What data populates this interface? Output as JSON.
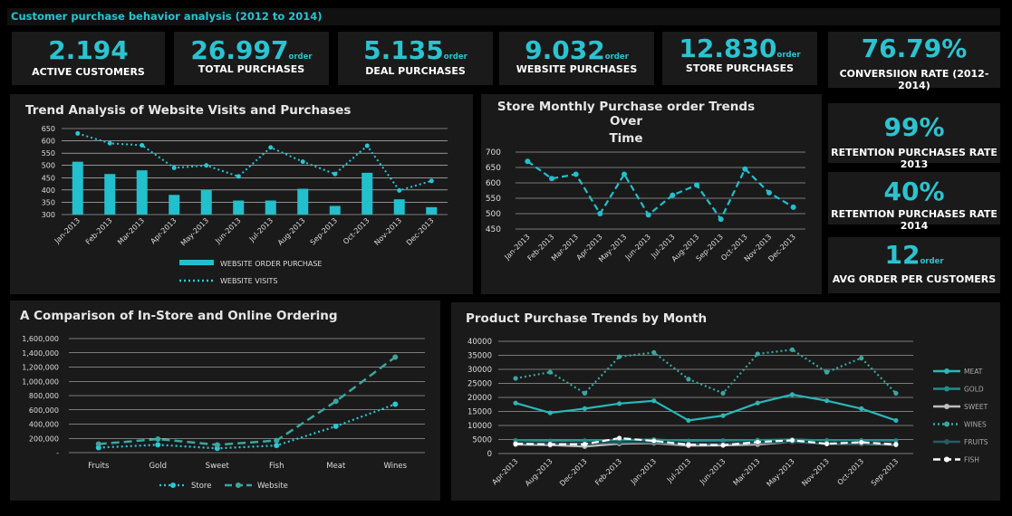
{
  "header": {
    "title": "Customer purchase behavior analysis (2012 to 2014)"
  },
  "kpis": [
    {
      "value": "2.194",
      "unit": "",
      "label": "ACTIVE CUSTOMERS"
    },
    {
      "value": "26.997",
      "unit": "order",
      "label": "TOTAL PURCHASES"
    },
    {
      "value": "5.135",
      "unit": "order",
      "label": "DEAL PURCHASES"
    },
    {
      "value": "9.032",
      "unit": "order",
      "label": "WEBSITE PURCHASES"
    },
    {
      "value": "12.830",
      "unit": "order",
      "label": "STORE PURCHASES"
    },
    {
      "value": "76.79%",
      "unit": "",
      "label": "CONVERSIION RATE (2012-2014)"
    }
  ],
  "side_kpis": [
    {
      "value": "99%",
      "unit": "",
      "label": "RETENTION PURCHASES RATE 2013"
    },
    {
      "value": "40%",
      "unit": "",
      "label": "RETENTION PURCHASES RATE 2014"
    },
    {
      "value": "12",
      "unit": "order",
      "label": "AVG ORDER PER CUSTOMERS"
    }
  ],
  "colors": {
    "accent": "#2cc3d0",
    "teal": "#3aa6a0",
    "panel": "#1a1a1a",
    "background": "#000000"
  },
  "chart_data": [
    {
      "type": "bar",
      "title": "Trend Analysis of Website Visits and Purchases",
      "categories": [
        "Jan-2013",
        "Feb-2013",
        "Mar-2013",
        "Apr-2013",
        "May-2013",
        "Jun-2013",
        "Jul-2013",
        "Aug-2013",
        "Sep-2013",
        "Oct-2013",
        "Nov-2013",
        "Dec-2013"
      ],
      "ylim": [
        300,
        650
      ],
      "yticks": [
        "650",
        "600",
        "550",
        "500",
        "450",
        "400",
        "350",
        "300"
      ],
      "series": [
        {
          "name": "WEBSITE ORDER PURCHASE",
          "type": "bar",
          "values": [
            515,
            465,
            480,
            380,
            400,
            357,
            357,
            405,
            335,
            470,
            362,
            330
          ]
        },
        {
          "name": "WEBSITE VISITS",
          "type": "line",
          "values": [
            630,
            590,
            582,
            490,
            500,
            455,
            573,
            515,
            465,
            580,
            398,
            437
          ]
        }
      ],
      "legend": "bottom",
      "grid": true
    },
    {
      "type": "line",
      "title": "Store Monthly Purchase order Trends Over Time",
      "title_lines": [
        "Store Monthly Purchase order Trends Over",
        "Time"
      ],
      "categories": [
        "Jan-2013",
        "Feb-2013",
        "Mar-2013",
        "Apr-2013",
        "May-2013",
        "Jun-2013",
        "Jul-2013",
        "Aug-2013",
        "Sep-2013",
        "Oct-2013",
        "Nov-2013",
        "Dec-2013"
      ],
      "ylim": [
        450,
        700
      ],
      "yticks": [
        "700",
        "650",
        "600",
        "550",
        "500",
        "450"
      ],
      "series": [
        {
          "values": [
            670,
            614,
            628,
            500,
            628,
            496,
            560,
            593,
            482,
            645,
            568,
            521
          ]
        }
      ],
      "grid": true
    },
    {
      "type": "line",
      "title": "A Comparison of In-Store and Online Ordering",
      "categories": [
        "Fruits",
        "Gold",
        "Sweet",
        "Fish",
        "Meat",
        "Wines"
      ],
      "ylim": [
        0,
        1600000
      ],
      "yticks": [
        "1,600,000",
        "1,400,000",
        "1,200,000",
        "1,000,000",
        "800,000",
        "600,000",
        "400,000",
        "200,000",
        "-"
      ],
      "series": [
        {
          "name": "Store",
          "values": [
            70000,
            110000,
            60000,
            100000,
            370000,
            680000
          ]
        },
        {
          "name": "Website",
          "values": [
            120000,
            190000,
            110000,
            170000,
            720000,
            1340000
          ]
        }
      ],
      "legend": "bottom",
      "grid": true
    },
    {
      "type": "line",
      "title": "Product Purchase Trends by Month",
      "categories": [
        "Apr-2013",
        "Aug-2013",
        "Dec-2013",
        "Feb-2013",
        "Jan-2013",
        "Jul-2013",
        "Jun-2013",
        "Mar-2013",
        "May-2013",
        "Nov-2013",
        "Oct-2013",
        "Sep-2013"
      ],
      "ylim": [
        0,
        40000
      ],
      "yticks": [
        "40000",
        "35000",
        "30000",
        "25000",
        "20000",
        "15000",
        "10000",
        "5000",
        "0"
      ],
      "series": [
        {
          "name": "MEAT",
          "color": "#2ab7b8",
          "style": "solid",
          "values": [
            18000,
            14500,
            16000,
            17800,
            18800,
            11800,
            13500,
            18000,
            21000,
            18800,
            16000,
            11800
          ]
        },
        {
          "name": "GOLD",
          "color": "#1f8f8a",
          "style": "solid",
          "values": [
            4700,
            4500,
            4600,
            4800,
            5000,
            4500,
            4600,
            4800,
            5000,
            4700,
            4700,
            4600
          ]
        },
        {
          "name": "SWEET",
          "color": "#bfbfbf",
          "style": "solid",
          "values": [
            3200,
            3000,
            2500,
            3500,
            3700,
            2800,
            2900,
            3200,
            4200,
            3400,
            3500,
            3100
          ]
        },
        {
          "name": "WINES",
          "color": "#3aa6a0",
          "style": "dotted",
          "values": [
            26800,
            29000,
            21500,
            34500,
            36000,
            26500,
            21500,
            35500,
            37000,
            29000,
            34000,
            21500
          ]
        },
        {
          "name": "FRUITS",
          "color": "#255c66",
          "style": "solid",
          "values": [
            3700,
            3500,
            3600,
            3900,
            4000,
            3400,
            3500,
            3800,
            4100,
            3500,
            3600,
            3400
          ]
        },
        {
          "name": "FISH",
          "color": "#ffffff",
          "style": "dashed",
          "values": [
            3500,
            3300,
            3300,
            5500,
            4500,
            3200,
            3000,
            4100,
            4700,
            3500,
            4000,
            3300
          ]
        }
      ],
      "legend": "right",
      "grid": true
    }
  ]
}
